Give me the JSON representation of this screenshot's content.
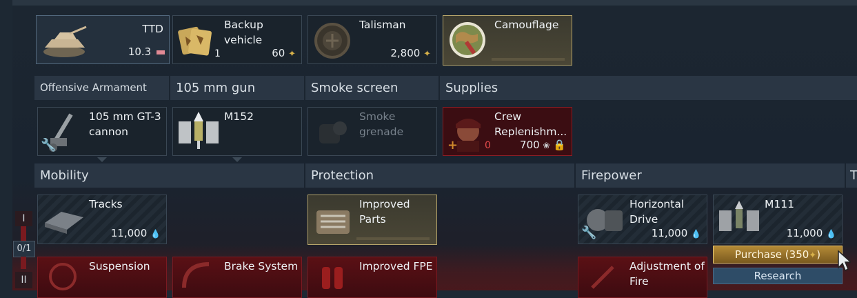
{
  "crew_slots": {
    "vehicle": {
      "name": "TTD",
      "rank": "10.3"
    },
    "backup": {
      "name": "Backup vehicle",
      "count": "1",
      "price": "60"
    },
    "talisman": {
      "name": "Talisman",
      "price": "2,800"
    },
    "camouflage": {
      "name": "Camouflage"
    }
  },
  "weapon_headers": {
    "offensive": "Offensive Armament",
    "gun": "105 mm gun",
    "smoke": "Smoke screen",
    "supplies": "Supplies"
  },
  "weapon_slots": {
    "cannon": {
      "name": "105 mm GT-3 cannon"
    },
    "shell": {
      "name": "M152"
    },
    "smoke": {
      "name": "Smoke grenade"
    },
    "crew": {
      "name": "Crew Replenishm...",
      "count": "0",
      "price": "700"
    }
  },
  "mod_headers": {
    "mobility": "Mobility",
    "protection": "Protection",
    "firepower": "Firepower",
    "next": "T"
  },
  "mods_row1": {
    "tracks": {
      "name": "Tracks",
      "price": "11,000"
    },
    "parts": {
      "name": "Improved Parts"
    },
    "drive": {
      "name": "Horizontal Drive",
      "price": "11,000"
    },
    "m111": {
      "name": "M111",
      "price": "11,000"
    }
  },
  "mods_row2": {
    "suspension": {
      "name": "Suspension"
    },
    "brake": {
      "name": "Brake System"
    },
    "fpe": {
      "name": "Improved FPE"
    },
    "adjust": {
      "name": "Adjustment of Fire"
    }
  },
  "ranks": {
    "r1": "I",
    "progress": "0/1",
    "r2": "II"
  },
  "popup": {
    "purchase": "Purchase (350",
    "purchase_close": ")",
    "research": "Research"
  },
  "colors": {
    "accent_gold": "#d8b24a",
    "research_blue": "#2e4c67",
    "locked_red": "#3b0d12"
  },
  "icons": {
    "eagle": "golden-eagle-icon",
    "rp": "research-points-icon",
    "lock": "lock-icon",
    "wrench": "wrench-icon"
  }
}
